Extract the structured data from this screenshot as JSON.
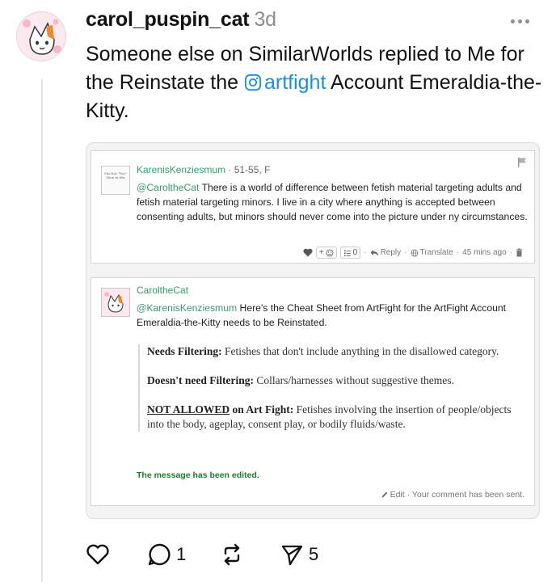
{
  "post": {
    "username": "carol_puspin_cat",
    "timestamp": "3d",
    "text_before": "Someone else on SimilarWorlds replied to Me for the Reinstate the ",
    "mention": "artfight",
    "text_after": " Account Emeraldia-the-Kitty."
  },
  "embed": {
    "comment1": {
      "author": "KarenisKenziesmum",
      "meta": " · 51-55, F",
      "mention": "@CaroltheCat",
      "body": " There is a world of difference between fetish material targeting adults and fetish material targeting minors. I live in a city where anything is accepted between consenting adults, but minors should never come into the picture under ny circumstances.",
      "avatar_text": "I'm Not \"Too\" Nice to Me",
      "react_label": "+",
      "count_label": "0",
      "reply_label": "Reply",
      "translate_label": "Translate",
      "time_label": "45 mins ago"
    },
    "comment2": {
      "author": "CaroltheCat",
      "mention": "@KarenisKenziesmum",
      "body": " Here's the Cheat Sheet from ArtFight for the ArtFight Account Emeraldia-the-Kitty needs to be Reinstated.",
      "quote": [
        {
          "label": "Needs Filtering:",
          "text": " Fetishes that don't include anything in the disallowed category."
        },
        {
          "label": "Doesn't need Filtering:",
          "text": " Collars/harnesses without suggestive themes."
        },
        {
          "label_underlined": "NOT ALLOWED",
          "label": " on Art Fight:",
          "text": " Fetishes involving the insertion of people/objects into the body, ageplay, consent play, or bodily fluids/waste."
        }
      ],
      "edited_note": "The message has been edited.",
      "edit_label": "Edit",
      "sent_label": "· Your comment has been sent."
    }
  },
  "actions": {
    "comments_count": "1",
    "shares_count": "5"
  },
  "colors": {
    "accent_link": "#1d8fd8",
    "username_green": "#3a9a6a",
    "edited_green": "#1f7a2e"
  }
}
